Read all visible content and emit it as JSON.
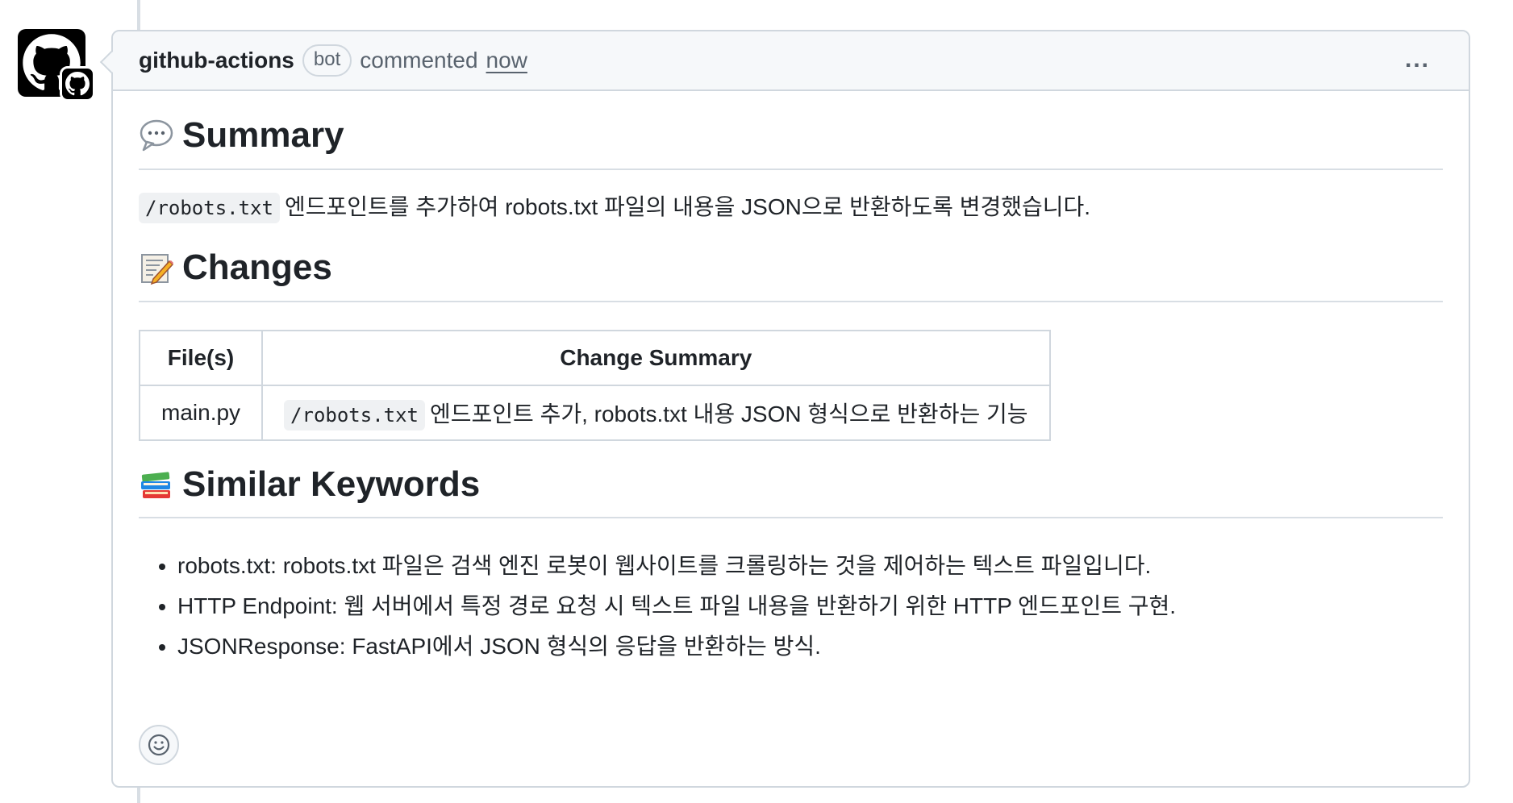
{
  "comment": {
    "author": "github-actions",
    "author_badge": "bot",
    "action": "commented",
    "timestamp": "now",
    "more_menu_label": "..."
  },
  "summary": {
    "title": "Summary",
    "emoji": "speech-balloon",
    "code": "/robots.txt",
    "text": "엔드포인트를 추가하여 robots.txt 파일의 내용을 JSON으로 반환하도록 변경했습니다."
  },
  "changes": {
    "title": "Changes",
    "emoji": "memo",
    "headers": [
      "File(s)",
      "Change Summary"
    ],
    "rows": [
      {
        "file": "main.py",
        "code": "/robots.txt",
        "summary": "엔드포인트 추가, robots.txt 내용 JSON 형식으로 반환하는 기능"
      }
    ]
  },
  "keywords": {
    "title": "Similar Keywords",
    "emoji": "books",
    "items": [
      "robots.txt: robots.txt 파일은 검색 엔진 로봇이 웹사이트를 크롤링하는 것을 제어하는 텍스트 파일입니다.",
      "HTTP Endpoint: 웹 서버에서 특정 경로 요청 시 텍스트 파일 내용을 반환하기 위한 HTTP 엔드포인트 구현.",
      "JSONResponse: FastAPI에서 JSON 형식의 응답을 반환하는 방식."
    ]
  },
  "icons": {
    "avatar": "github-octocat-icon",
    "reaction": "smiley-icon"
  },
  "colors": {
    "border": "#d0d7de",
    "header_bg": "#f6f8fa",
    "muted_text": "#59636e",
    "code_bg": "#eff1f3"
  }
}
